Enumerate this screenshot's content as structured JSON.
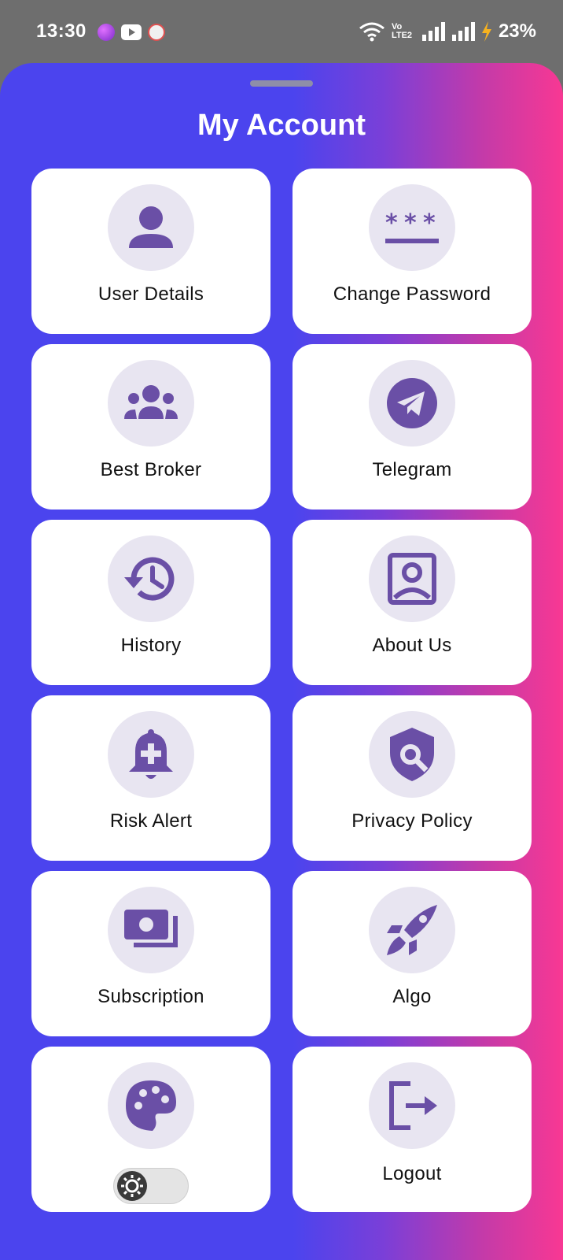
{
  "status_bar": {
    "time": "13:30",
    "battery": "23%",
    "network": "Vo LTE2",
    "app_colors": [
      "#b44fe0",
      "#ffffff",
      "#e0e0e0"
    ]
  },
  "sheet": {
    "title": "My Account",
    "gradient": [
      "#4b44ee",
      "#f83893"
    ]
  },
  "colors": {
    "icon": "#6a4fa6",
    "icon_bg": "#e8e5f1",
    "card_bg": "#ffffff"
  },
  "menu": [
    {
      "label": "User Details",
      "icon": "person-icon"
    },
    {
      "label": "Change Password",
      "icon": "password-icon"
    },
    {
      "label": "Best Broker",
      "icon": "group-icon"
    },
    {
      "label": "Telegram",
      "icon": "telegram-icon"
    },
    {
      "label": "History",
      "icon": "history-icon"
    },
    {
      "label": "About Us",
      "icon": "contact-portrait-icon"
    },
    {
      "label": "Risk Alert",
      "icon": "notification-add-icon"
    },
    {
      "label": "Privacy Policy",
      "icon": "shield-search-icon"
    },
    {
      "label": "Subscription",
      "icon": "payments-icon"
    },
    {
      "label": "Algo",
      "icon": "rocket-icon"
    },
    {
      "label": "",
      "icon": "palette-icon",
      "toggle": "theme-toggle",
      "toggle_icon": "sun-icon"
    },
    {
      "label": "Logout",
      "icon": "logout-icon"
    }
  ]
}
